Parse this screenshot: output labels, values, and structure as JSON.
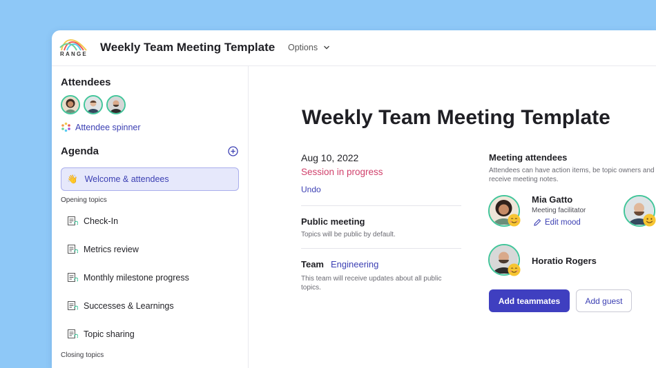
{
  "header": {
    "logo_text": "RANGE",
    "title": "Weekly Team Meeting Template",
    "options_label": "Options"
  },
  "sidebar": {
    "attendees_title": "Attendees",
    "attendee_spinner_label": "Attendee spinner",
    "agenda_title": "Agenda",
    "active_item": {
      "emoji": "👋",
      "label": "Welcome & attendees"
    },
    "opening_label": "Opening topics",
    "topics": [
      {
        "label": "Check-In"
      },
      {
        "label": "Metrics review"
      },
      {
        "label": "Monthly milestone progress"
      },
      {
        "label": "Successes & Learnings"
      },
      {
        "label": "Topic sharing"
      }
    ],
    "closing_label": "Closing topics"
  },
  "main": {
    "title": "Weekly Team Meeting Template",
    "date": "Aug 10, 2022",
    "session_status": "Session in progress",
    "undo_label": "Undo",
    "public_title": "Public meeting",
    "public_desc": "Topics will be public by default.",
    "team_label": "Team",
    "team_value": "Engineering",
    "team_desc": "This team will receive updates about all public topics."
  },
  "attendees_panel": {
    "title": "Meeting attendees",
    "desc_line1": "Attendees can have action items, be topic owners and",
    "desc_line2": "receive meeting notes.",
    "people": [
      {
        "name": "Mia Gatto",
        "role": "Meeting facilitator",
        "edit_label": "Edit mood"
      },
      {
        "name": "Horatio Rogers"
      }
    ],
    "add_teammates_label": "Add teammates",
    "add_guest_label": "Add guest"
  },
  "colors": {
    "background": "#8ec8f7",
    "accent": "#3f3fc0",
    "session": "#d0406b",
    "avatar_ring": "#42c59a"
  }
}
